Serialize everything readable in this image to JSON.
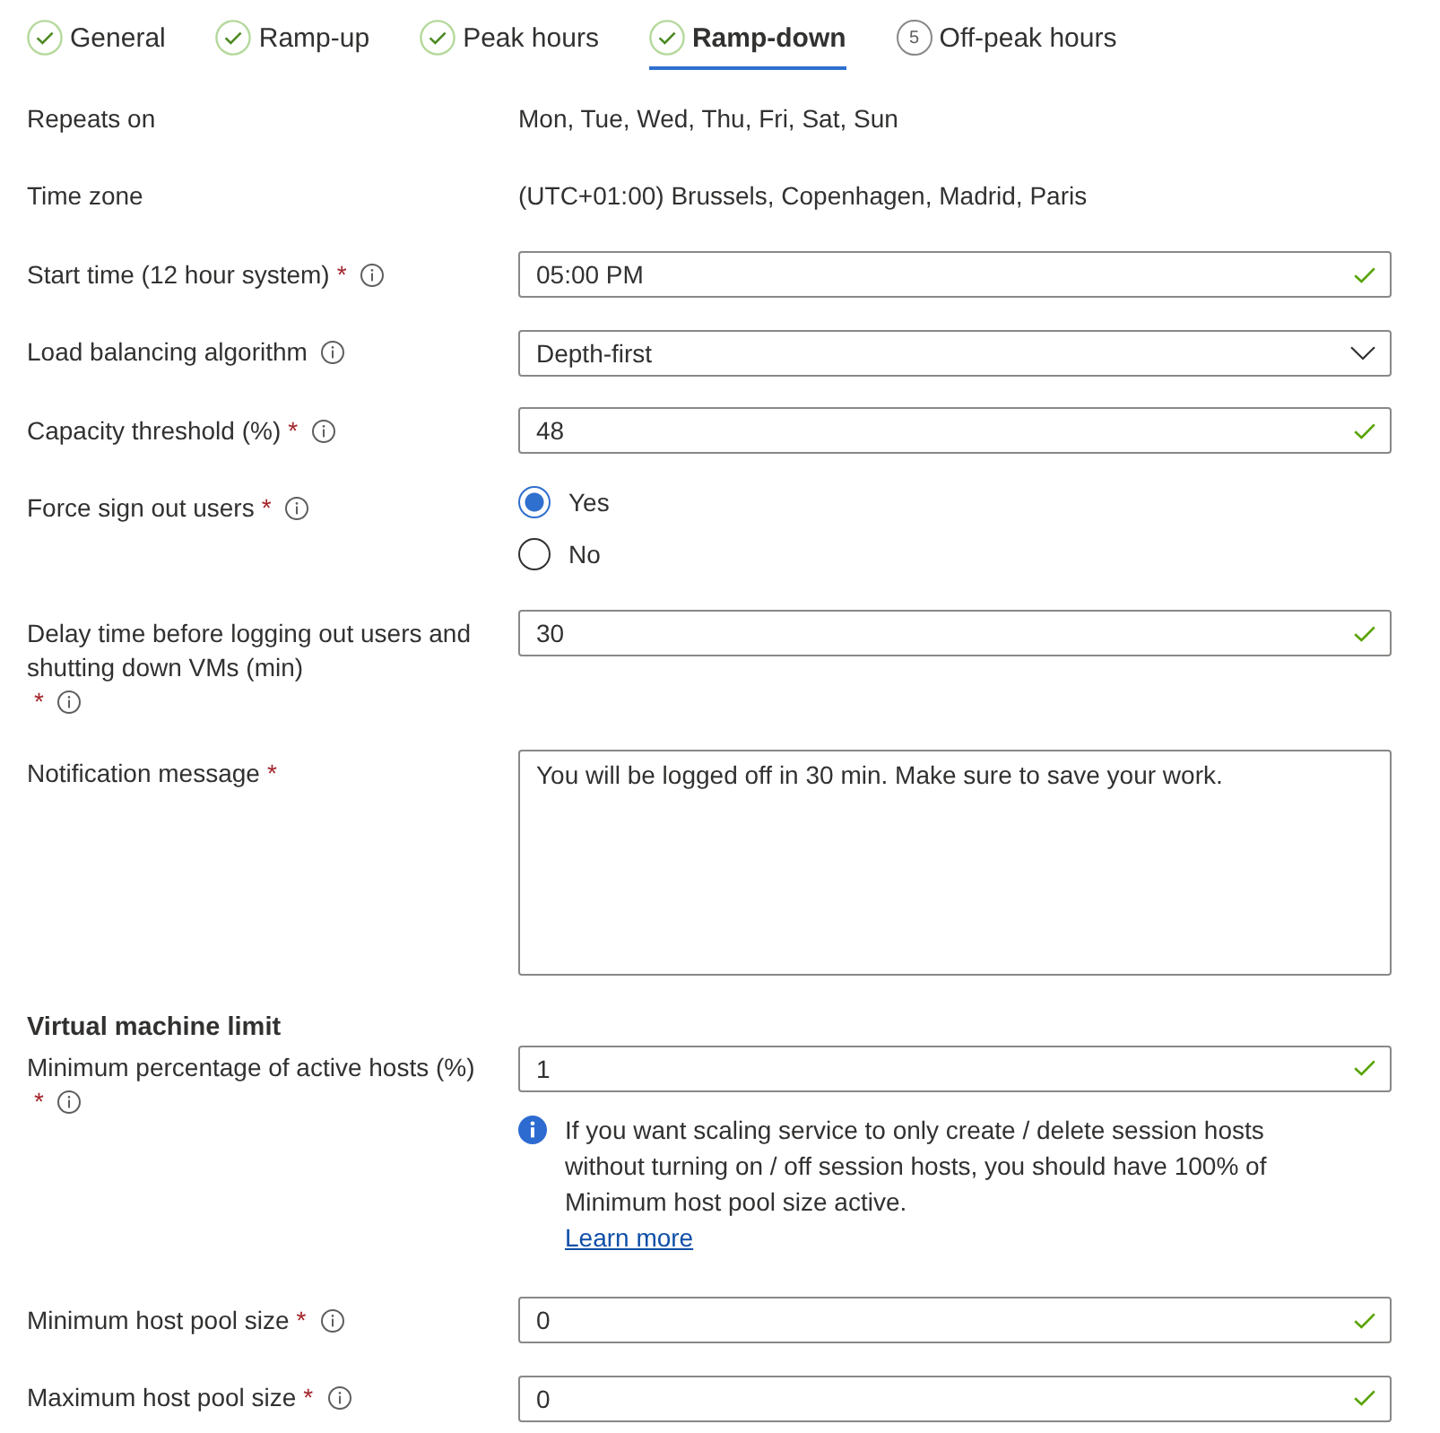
{
  "tabs": [
    {
      "label": "General",
      "selected": false,
      "kind": "done"
    },
    {
      "label": "Ramp-up",
      "selected": false,
      "kind": "done"
    },
    {
      "label": "Peak hours",
      "selected": false,
      "kind": "done"
    },
    {
      "label": "Ramp-down",
      "selected": true,
      "kind": "done"
    },
    {
      "label": "Off-peak hours",
      "selected": false,
      "kind": "step",
      "step": "5"
    }
  ],
  "fields": [
    {
      "kind": "text",
      "label": "Repeats on",
      "value": "Mon, Tue, Wed, Thu, Fri, Sat, Sun"
    },
    {
      "kind": "text",
      "label": "Time zone",
      "value": "(UTC+01:00) Brussels, Copenhagen, Madrid, Paris"
    },
    {
      "kind": "input",
      "label": "Start time (12 hour system)",
      "required_mark": "*",
      "info": true,
      "value": "05:00 PM",
      "valid": true
    },
    {
      "kind": "dropdown",
      "label": "Load balancing algorithm",
      "info": true,
      "value": "Depth-first"
    },
    {
      "kind": "input",
      "label": "Capacity threshold (%)",
      "required_mark": "*",
      "info": true,
      "value": "48",
      "valid": true
    },
    {
      "kind": "radio",
      "label": "Force sign out users",
      "required_mark": "*",
      "info": true,
      "options": [
        {
          "label": "Yes",
          "selected": true
        },
        {
          "label": "No",
          "selected": false
        }
      ]
    },
    {
      "kind": "input",
      "label": "Delay time before logging out users and shutting down VMs (min)",
      "required_mark": "*",
      "info": true,
      "value": "30",
      "valid": true
    },
    {
      "kind": "textarea",
      "label": "Notification message",
      "required_mark": "*",
      "value": "You will be logged off in 30 min. Make sure to save your work."
    }
  ],
  "vm_limit": {
    "heading": "Virtual machine limit",
    "fields": [
      {
        "kind": "input",
        "label": "Minimum percentage of active hosts (%)",
        "required_mark": "*",
        "info": true,
        "value": "1",
        "valid": true,
        "note": {
          "text": "If you want scaling service to only create / delete session hosts without turning on / off session hosts, you should have 100% of Minimum host pool size active.",
          "link": "Learn more"
        }
      },
      {
        "kind": "input",
        "label": "Minimum host pool size",
        "required_mark": "*",
        "info": true,
        "value": "0",
        "valid": true
      },
      {
        "kind": "input",
        "label": "Maximum host pool size",
        "required_mark": "*",
        "info": true,
        "value": "0",
        "valid": true
      }
    ]
  }
}
